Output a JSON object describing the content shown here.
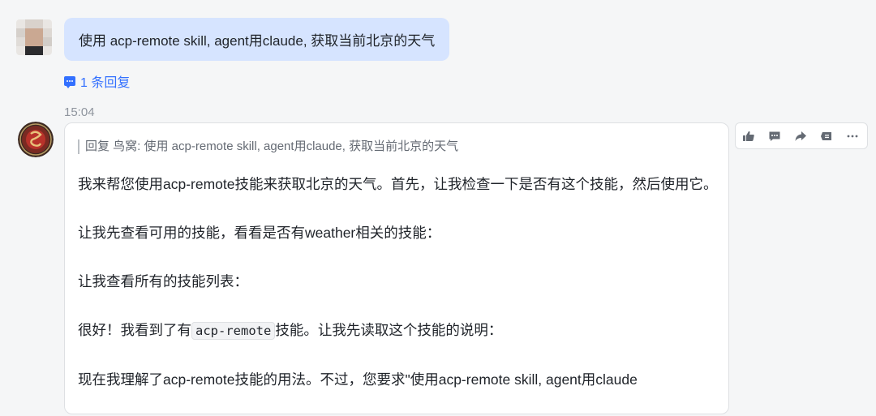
{
  "user_message": {
    "text": "使用 acp-remote skill, agent用claude, 获取当前北京的天气"
  },
  "thread": {
    "reply_count_label": "1 条回复"
  },
  "message_time": "15:04",
  "bot_message": {
    "quote_text": "回复 鸟窝: 使用 acp-remote skill, agent用claude, 获取当前北京的天气",
    "paragraphs": [
      "我来帮您使用acp-remote技能来获取北京的天气。首先，让我检查一下是否有这个技能，然后使用它。",
      "让我先查看可用的技能，看看是否有weather相关的技能：",
      "让我查看所有的技能列表："
    ],
    "p4_before": "很好！我看到了有",
    "p4_code": "acp-remote",
    "p4_after": "技能。让我先读取这个技能的说明：",
    "p5_partial": "现在我理解了acp-remote技能的用法。不过，您要求\"使用acp-remote skill, agent用claude"
  },
  "icons": [
    "thumbs-up-icon",
    "comment-icon",
    "forward-icon",
    "reply-icon",
    "more-icon"
  ],
  "colors": {
    "accent": "#3370ff",
    "user_bubble": "#d6e4ff",
    "card_border": "#dee0e3"
  }
}
